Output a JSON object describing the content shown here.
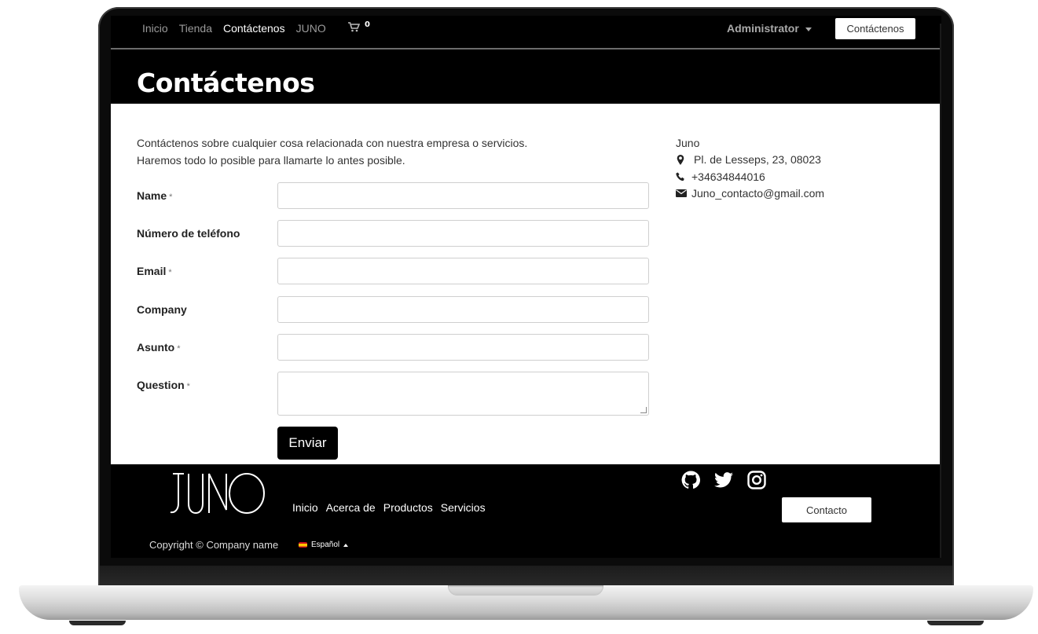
{
  "nav": {
    "links": [
      "Inicio",
      "Tienda",
      "Contáctenos",
      "JUNO"
    ],
    "active_index": 2,
    "cart_icon": "cart-icon",
    "cart_count": "0",
    "user": "Administrator",
    "cta": "Contáctenos"
  },
  "header": {
    "title": "Contáctenos"
  },
  "intro": {
    "line1": "Contáctenos sobre cualquier cosa relacionada con nuestra empresa o servicios.",
    "line2": "Haremos todo lo posible para llamarte lo antes posible."
  },
  "form": {
    "fields": [
      {
        "label": "Name",
        "required": "*",
        "value": ""
      },
      {
        "label": "Número de teléfono",
        "required": "",
        "value": ""
      },
      {
        "label": "Email",
        "required": "*",
        "value": ""
      },
      {
        "label": "Company",
        "required": "",
        "value": ""
      },
      {
        "label": "Asunto",
        "required": "*",
        "value": ""
      },
      {
        "label": "Question",
        "required": "*",
        "value": ""
      }
    ],
    "submit": "Enviar"
  },
  "contact": {
    "company": "Juno",
    "address": "Pl. de Lesseps, 23, 08023",
    "phone": "+34634844016",
    "email": "Juno_contacto@gmail.com",
    "icons": [
      "map-marker-icon",
      "phone-icon",
      "envelope-icon"
    ]
  },
  "footer": {
    "logo": "JUNO",
    "links": [
      "Inicio",
      "Acerca de",
      "Productos",
      "Servicios"
    ],
    "social_icons": [
      "github-icon",
      "twitter-icon",
      "instagram-icon"
    ],
    "cta": "Contacto",
    "copyright": "Copyright © Company name",
    "language": "Español"
  },
  "colors": {
    "background": "#000000",
    "content": "#ffffff",
    "button": "#000000"
  }
}
